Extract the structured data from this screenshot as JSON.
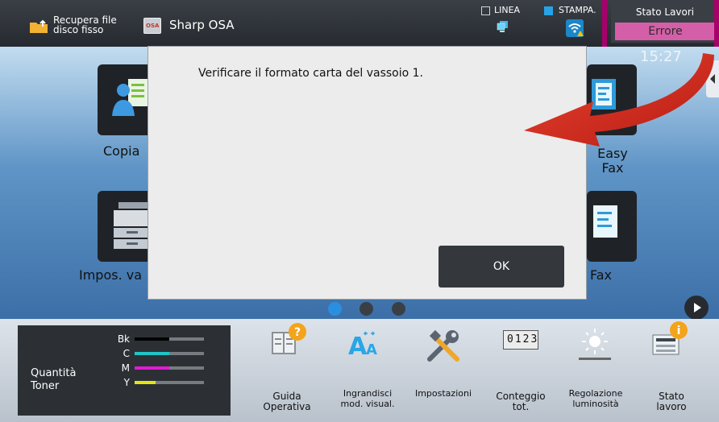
{
  "topbar": {
    "recupera_label": "Recupera file disco fisso",
    "app_label": "Sharp OSA",
    "osa_badge": "OSA",
    "linea_label": "LINEA",
    "stampa_label": "STAMPA.",
    "stato_lavori_label": "Stato Lavori",
    "errore_label": "Errore"
  },
  "home": {
    "time": "15:27",
    "tiles": [
      {
        "label": "Copia",
        "icon": "copy-icon"
      },
      {
        "label": "Easy Fax",
        "icon": "easy-fax-icon"
      },
      {
        "label": "Impos. va",
        "icon": "tray-settings-icon"
      },
      {
        "label": "Fax",
        "icon": "fax-icon"
      }
    ],
    "page_dots": 3,
    "active_page": 1
  },
  "dialog": {
    "message": "Verificare il formato carta del vassoio 1.",
    "ok_label": "OK"
  },
  "toner": {
    "title": "Quantità Toner",
    "rows": [
      {
        "label": "Bk",
        "level": 0.5,
        "color": "#000000"
      },
      {
        "label": "C",
        "level": 0.5,
        "color": "#20c6c6"
      },
      {
        "label": "M",
        "level": 0.5,
        "color": "#e21ad4"
      },
      {
        "label": "Y",
        "level": 0.3,
        "color": "#e5e515"
      }
    ]
  },
  "bottom_items": [
    {
      "label": "Guida Operativa",
      "icon": "guide-icon"
    },
    {
      "label": "Ingrandisci mod. visual.",
      "icon": "zoom-display-icon"
    },
    {
      "label": "Impostazioni",
      "icon": "settings-tools-icon"
    },
    {
      "label": "Conteggio tot.",
      "icon": "counter-icon",
      "counter": "0123"
    },
    {
      "label": "Regolazione luminosità",
      "icon": "brightness-icon"
    },
    {
      "label": "Stato lavoro",
      "icon": "job-status-icon"
    }
  ],
  "colors": {
    "accent_pink": "#d45fa8",
    "highlight_frame": "#a8006a",
    "arrow_red": "#d52b1e",
    "stampa_blue": "#27a3e5"
  }
}
